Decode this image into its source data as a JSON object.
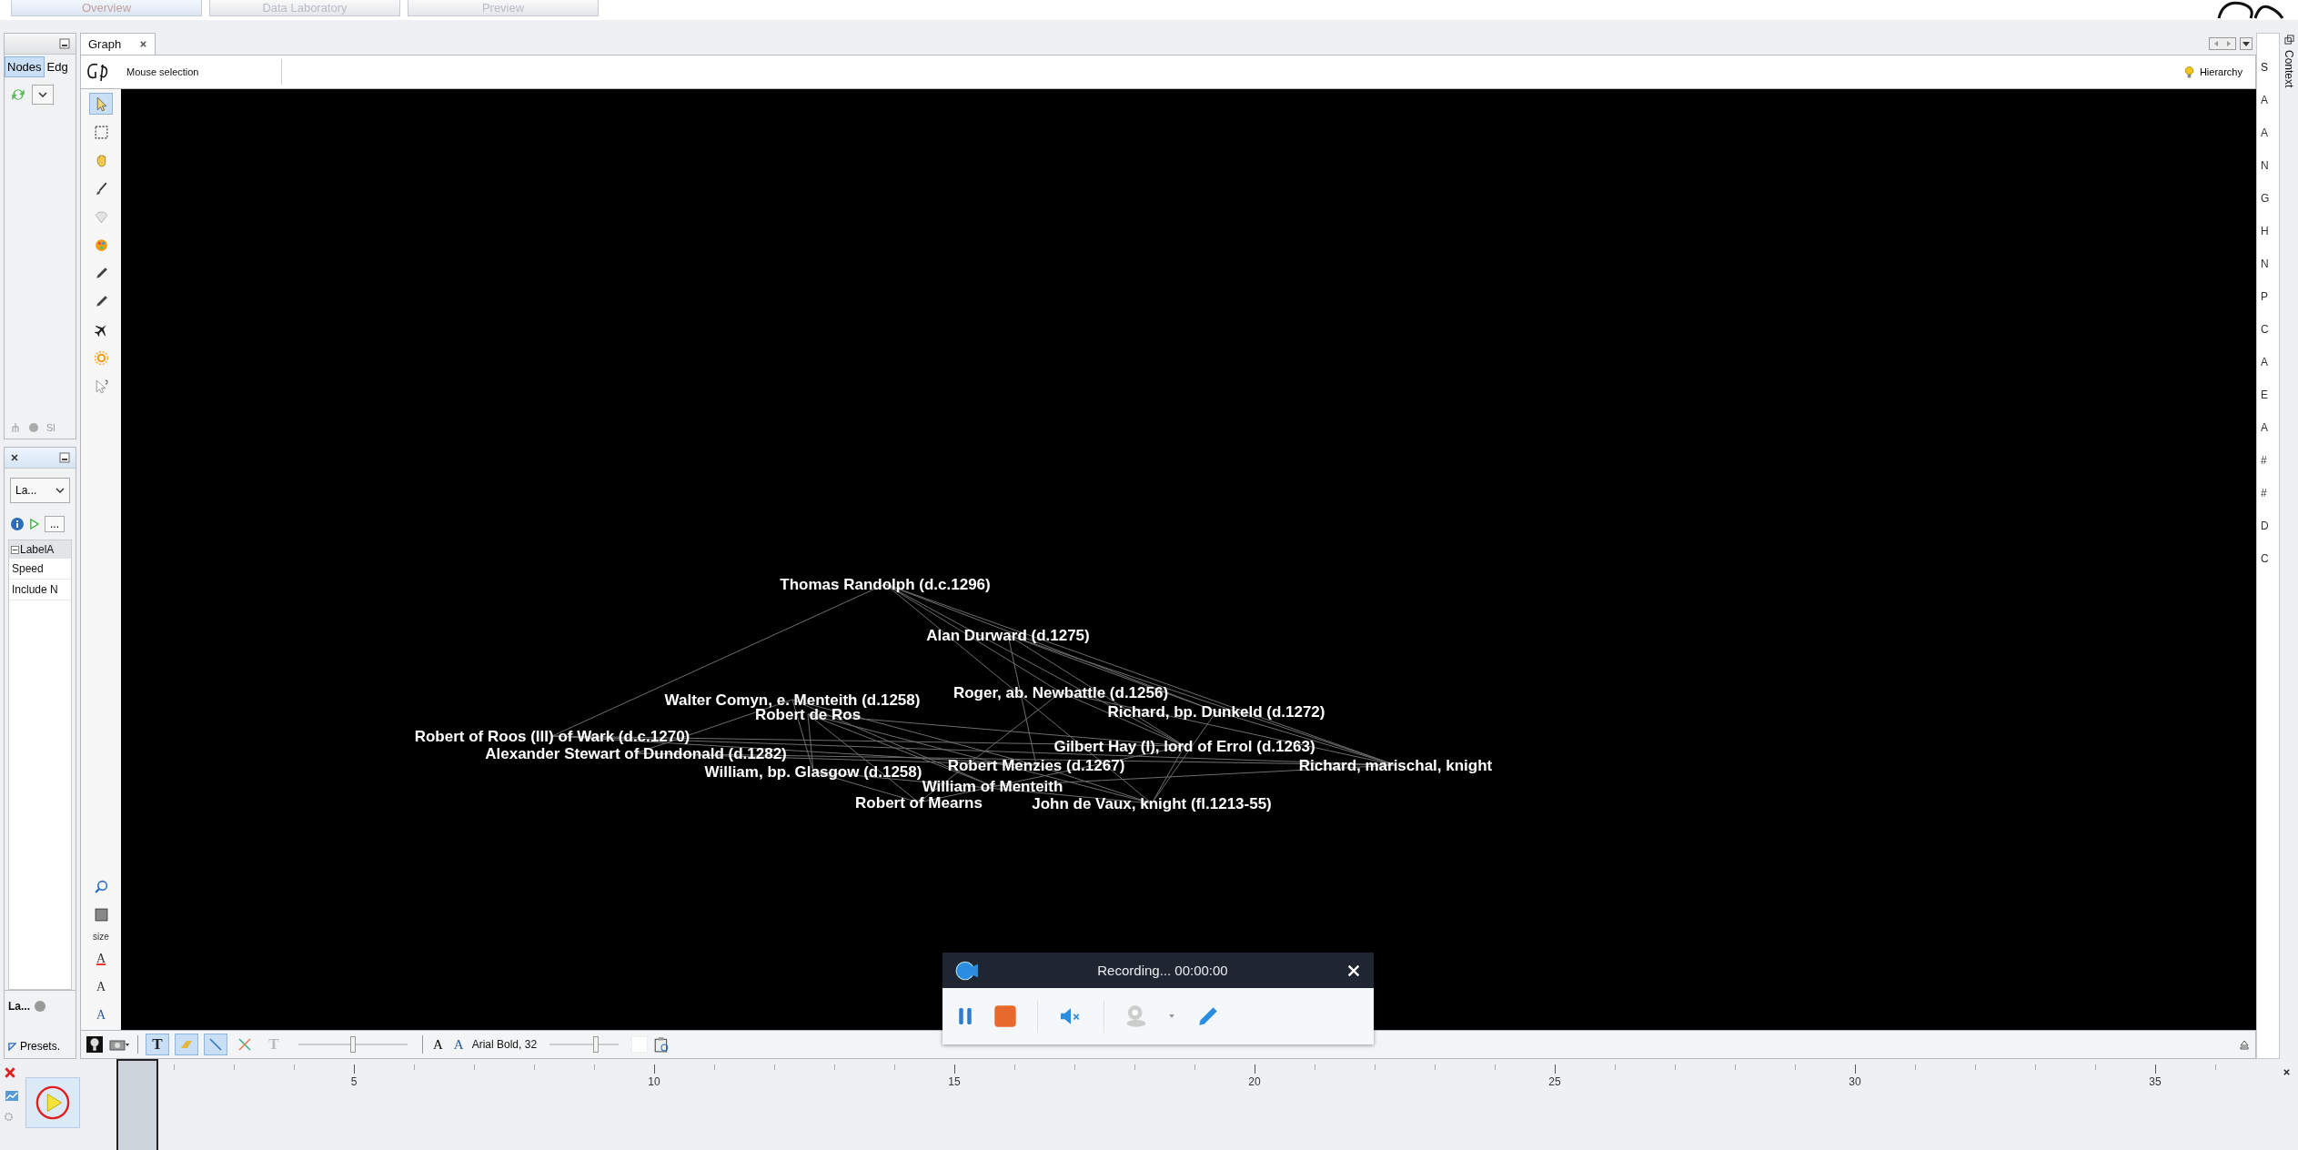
{
  "top_tabs": [
    {
      "label": "Overview",
      "selected": true
    },
    {
      "label": "Data Laboratory",
      "selected": false
    },
    {
      "label": "Preview",
      "selected": false
    }
  ],
  "appearance_panel": {
    "tabs": [
      {
        "label": "Nodes",
        "selected": true
      },
      {
        "label": "Edg",
        "selected": false
      }
    ],
    "footer_label": "Sl"
  },
  "layout_panel": {
    "dropdown": "La...",
    "more_button": "...",
    "properties": [
      {
        "kind": "header",
        "label": "LabelA"
      },
      {
        "kind": "row",
        "label": "Speed"
      },
      {
        "kind": "row",
        "label": "Include N"
      }
    ],
    "footer_label": "La...",
    "presets": "Presets."
  },
  "graph_window": {
    "tab": "Graph",
    "mode": "Mouse selection",
    "hierarchy": "Hierarchy"
  },
  "tools": [
    {
      "kind": "pointer",
      "selected": true
    },
    {
      "kind": "rect",
      "selected": false
    },
    {
      "kind": "hand",
      "selected": false
    },
    {
      "kind": "brush",
      "selected": false
    },
    {
      "kind": "diamond",
      "selected": false
    },
    {
      "kind": "palette",
      "selected": false
    },
    {
      "kind": "pencil",
      "selected": false
    },
    {
      "kind": "pencil",
      "selected": false
    },
    {
      "kind": "airplane",
      "selected": false
    },
    {
      "kind": "sun",
      "selected": false
    },
    {
      "kind": "help",
      "selected": false
    }
  ],
  "lower_tools": {
    "size_label": "size",
    "text_tools": [
      {
        "kind": "color",
        "glyph": "A"
      },
      {
        "kind": "size",
        "glyph": "A"
      },
      {
        "kind": "scale",
        "glyph": "A"
      }
    ]
  },
  "graph": {
    "nodes": [
      "Thomas Randolph (d.c.1296)",
      "Alan Durward (d.1275)",
      "Roger, ab. Newbattle (d.1256)",
      "Walter Comyn, e. Menteith (d.1258)",
      "Robert de Ros",
      "Richard, bp. Dunkeld (d.1272)",
      "Robert of Roos (III) of Wark (d.c.1270)",
      "Gilbert Hay (I), lord of Errol (d.1263)",
      "Alexander Stewart of Dundonald (d.1282)",
      "Robert Menzies (d.1267)",
      "Richard, marischal, knight",
      "William, bp. Glasgow (d.1258)",
      "William of Menteith",
      "Robert of Mearns",
      "John de Vaux, knight (fl.1213-55)"
    ]
  },
  "bottom_toolbar": {
    "toggles": [
      {
        "kind": "text",
        "glyph": "T",
        "selected": true
      },
      {
        "kind": "label-size",
        "selected": true
      },
      {
        "kind": "edge",
        "selected": true
      },
      {
        "kind": "edge-color",
        "selected": false
      },
      {
        "kind": "text-outline",
        "glyph": "T",
        "selected": false
      }
    ],
    "sliders": [
      {
        "level": 0.5
      },
      {
        "level": 0.67
      }
    ],
    "font_glyphs": [
      "A",
      "A"
    ],
    "font": "Arial Bold, 32"
  },
  "recorder": {
    "status": "Recording... 00:00:00"
  },
  "timeline": {
    "tick_labels": [
      "5",
      "10",
      "15",
      "20",
      "25",
      "30",
      "35"
    ]
  },
  "context_panel": {
    "tab": "S",
    "title": "Context",
    "rows": [
      "A",
      "A",
      "N",
      "G",
      "H",
      "N",
      "P",
      "C",
      "A",
      "E",
      "A",
      "#",
      "#",
      "D",
      "C"
    ]
  }
}
